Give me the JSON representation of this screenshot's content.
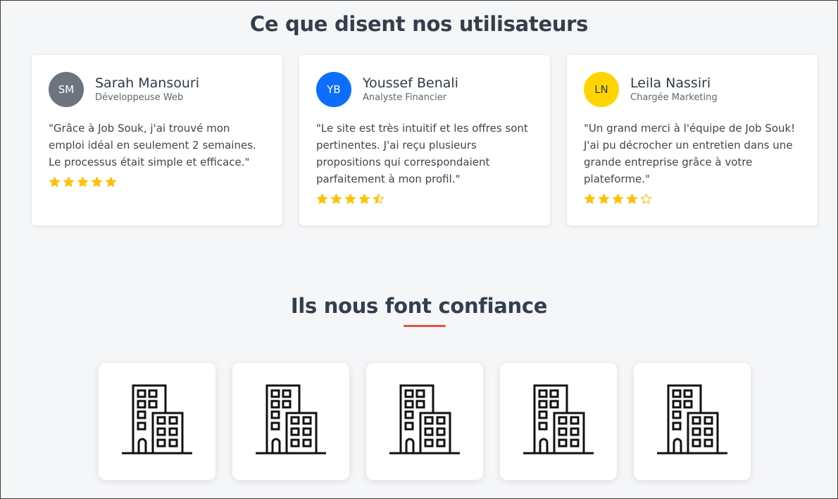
{
  "testimonials": {
    "title": "Ce que disent nos utilisateurs",
    "items": [
      {
        "initials": "SM",
        "name": "Sarah Mansouri",
        "role": "Développeuse Web",
        "quote": "\"Grâce à Job Souk, j'ai trouvé mon emploi idéal en seulement 2 semaines. Le processus était simple et efficace.\"",
        "rating": 5,
        "avatar_color": "#6c757d"
      },
      {
        "initials": "YB",
        "name": "Youssef Benali",
        "role": "Analyste Financier",
        "quote": "\"Le site est très intuitif et les offres sont pertinentes. J'ai reçu plusieurs propositions qui correspondaient parfaitement à mon profil.\"",
        "rating": 4.5,
        "avatar_color": "#0d6efd"
      },
      {
        "initials": "LN",
        "name": "Leila Nassiri",
        "role": "Chargée Marketing",
        "quote": "\"Un grand merci à l'équipe de Job Souk! J'ai pu décrocher un entretien dans une grande entreprise grâce à votre plateforme.\"",
        "rating": 4,
        "avatar_color": "#ffd500"
      }
    ]
  },
  "partners": {
    "title": "Ils nous font confiance",
    "logos": [
      {
        "icon": "building-icon"
      },
      {
        "icon": "building-icon"
      },
      {
        "icon": "building-icon"
      },
      {
        "icon": "building-icon"
      },
      {
        "icon": "building-icon"
      }
    ]
  },
  "colors": {
    "star": "#ffc107",
    "accent_underline": "#e0543f",
    "background": "#f5f6f8"
  }
}
